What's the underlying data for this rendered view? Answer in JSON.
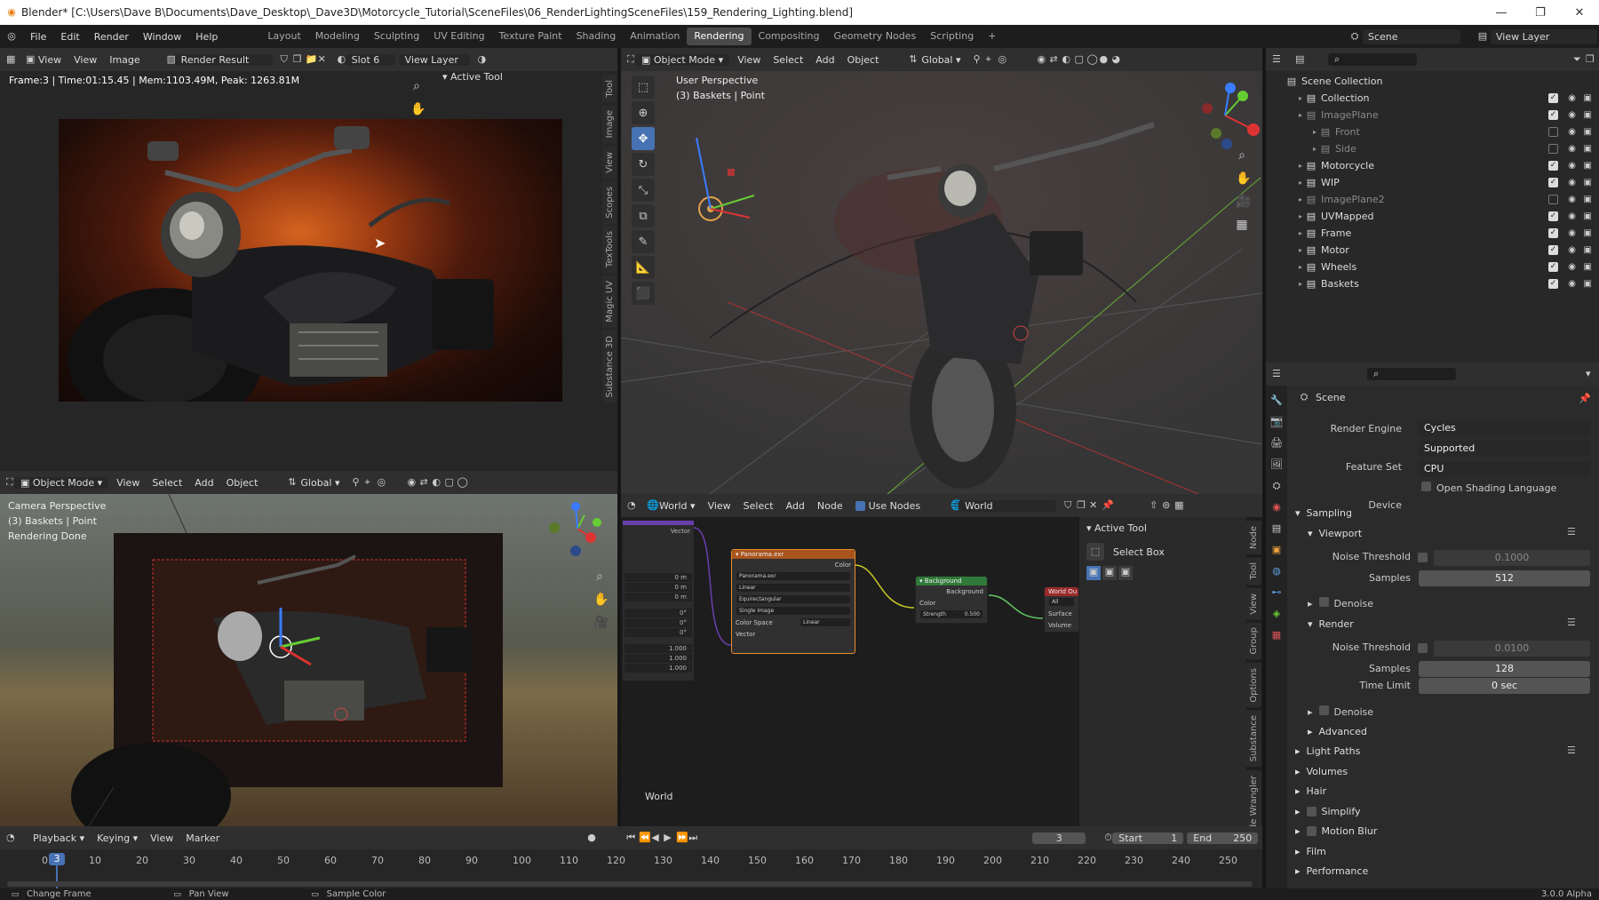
{
  "window": {
    "title": "Blender* [C:\\Users\\Dave B\\Documents\\Dave_Desktop\\_Dave3D\\Motorcycle_Tutorial\\SceneFiles\\06_RenderLightingSceneFiles\\159_Rendering_Lighting.blend]",
    "controls": [
      "—",
      "❐",
      "✕"
    ]
  },
  "topbar": {
    "menus": [
      "File",
      "Edit",
      "Render",
      "Window",
      "Help"
    ],
    "workspaces": [
      "Layout",
      "Modeling",
      "Sculpting",
      "UV Editing",
      "Texture Paint",
      "Shading",
      "Animation",
      "Rendering",
      "Compositing",
      "Geometry Nodes",
      "Scripting"
    ],
    "active_workspace": "Rendering",
    "add": "+",
    "scene": "Scene",
    "view_layer": "View Layer"
  },
  "image_editor": {
    "menus": [
      "View",
      "View",
      "Image"
    ],
    "image_name": "Render Result",
    "slot": "Slot 6",
    "layer": "View Layer",
    "stats": "Frame:3 | Time:01:15.45 | Mem:1103.49M, Peak: 1263.81M",
    "active_tool": "Active Tool",
    "side_tabs": [
      "Tool",
      "Image",
      "View",
      "Scopes",
      "TexTools",
      "Magic UV",
      "Substance 3D"
    ]
  },
  "viewport": {
    "mode": "Object Mode",
    "menus": [
      "View",
      "Select",
      "Add",
      "Object"
    ],
    "orientation": "Global",
    "info_line1": "User Perspective",
    "info_line2": "(3) Baskets | Point"
  },
  "camera_view": {
    "mode": "Object Mode",
    "menus": [
      "View",
      "Select",
      "Add",
      "Object"
    ],
    "orientation": "Global",
    "info_line1": "Camera Perspective",
    "info_line2": "(3) Baskets | Point",
    "info_line3": "Rendering Done"
  },
  "node_editor": {
    "type": "World",
    "menus": [
      "View",
      "Select",
      "Add",
      "Node"
    ],
    "use_nodes": "Use Nodes",
    "world_name": "World",
    "bottom_label": "World",
    "active_tool": "Active Tool",
    "select_box": "Select Box",
    "side_tabs": [
      "Node",
      "Tool",
      "View",
      "Group",
      "Options",
      "Substance",
      "Node Wrangler"
    ],
    "left_values": [
      "0 m",
      "0 m",
      "0 m",
      "0°",
      "0°",
      "0°",
      "1.000",
      "1.000",
      "1.000"
    ],
    "left_vector": "Vector",
    "env_node": {
      "title": "Panorama.exr",
      "out_color": "Color",
      "image": "Panorama.exr",
      "interp": "Linear",
      "proj": "Equirectangular",
      "source": "Single Image",
      "cs_label": "Color Space",
      "cs_value": "Linear",
      "in_vector": "Vector"
    },
    "bg_node": {
      "title": "Background",
      "out": "Background",
      "color": "Color",
      "strength_label": "Strength",
      "strength": "0.500"
    },
    "out_node": {
      "title": "World Ou",
      "target": "All",
      "surface": "Surface",
      "volume": "Volume"
    }
  },
  "outliner": {
    "root": "Scene Collection",
    "rows": [
      {
        "name": "Collection",
        "indent": 0,
        "dim": false,
        "checked": true
      },
      {
        "name": "ImagePlane",
        "indent": 0,
        "dim": true,
        "checked": true
      },
      {
        "name": "Front",
        "indent": 1,
        "dim": true,
        "checked": false
      },
      {
        "name": "Side",
        "indent": 1,
        "dim": true,
        "checked": false
      },
      {
        "name": "Motorcycle",
        "indent": 0,
        "dim": false,
        "checked": true
      },
      {
        "name": "WIP",
        "indent": 0,
        "dim": false,
        "checked": true
      },
      {
        "name": "ImagePlane2",
        "indent": 0,
        "dim": true,
        "checked": false
      },
      {
        "name": "UVMapped",
        "indent": 0,
        "dim": false,
        "checked": true
      },
      {
        "name": "Frame",
        "indent": 0,
        "dim": false,
        "checked": true
      },
      {
        "name": "Motor",
        "indent": 0,
        "dim": false,
        "checked": true
      },
      {
        "name": "Wheels",
        "indent": 0,
        "dim": false,
        "checked": true
      },
      {
        "name": "Baskets",
        "indent": 0,
        "dim": false,
        "checked": true
      }
    ]
  },
  "properties": {
    "context": "Scene",
    "render_engine_label": "Render Engine",
    "render_engine": "Cycles",
    "feature_set_label": "Feature Set",
    "feature_set": "Supported",
    "device_label": "Device",
    "device": "CPU",
    "osl": "Open Shading Language",
    "sampling": "Sampling",
    "viewport": "Viewport",
    "noise_threshold_label": "Noise Threshold",
    "viewport_noise": "0.1000",
    "samples_label": "Samples",
    "viewport_samples": "512",
    "denoise": "Denoise",
    "render": "Render",
    "render_noise": "0.0100",
    "render_samples": "128",
    "time_limit_label": "Time Limit",
    "time_limit": "0 sec",
    "advanced": "Advanced",
    "sections": [
      "Light Paths",
      "Volumes",
      "Hair",
      "Simplify",
      "Motion Blur",
      "Film",
      "Performance"
    ]
  },
  "timeline": {
    "menus": [
      "Playback",
      "Keying",
      "View",
      "Marker"
    ],
    "current_frame": "3",
    "start_label": "Start",
    "start": "1",
    "end_label": "End",
    "end": "250",
    "ticks": [
      "0",
      "10",
      "20",
      "30",
      "40",
      "50",
      "60",
      "70",
      "80",
      "90",
      "100",
      "110",
      "120",
      "130",
      "140",
      "150",
      "160",
      "170",
      "180",
      "190",
      "200",
      "210",
      "220",
      "230",
      "240",
      "250"
    ],
    "playhead": "3"
  },
  "statusbar": {
    "items": [
      "Change Frame",
      "Pan View",
      "Sample Color"
    ],
    "version": "3.0.0 Alpha"
  }
}
